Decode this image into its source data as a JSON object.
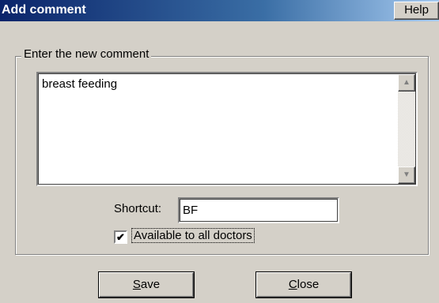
{
  "window": {
    "title": "Add comment",
    "help_label": "Help"
  },
  "comment_group": {
    "label": "Enter the new comment",
    "comment_text": "breast feeding"
  },
  "shortcut": {
    "label": "Shortcut:",
    "value": "BF"
  },
  "available": {
    "checked": true,
    "check_mark": "✔",
    "label": "Available to all doctors"
  },
  "buttons": {
    "save_accel": "S",
    "save_rest": "ave",
    "close_accel": "C",
    "close_rest": "lose"
  },
  "icons": {
    "scroll_up": "▲",
    "scroll_down": "▼"
  }
}
